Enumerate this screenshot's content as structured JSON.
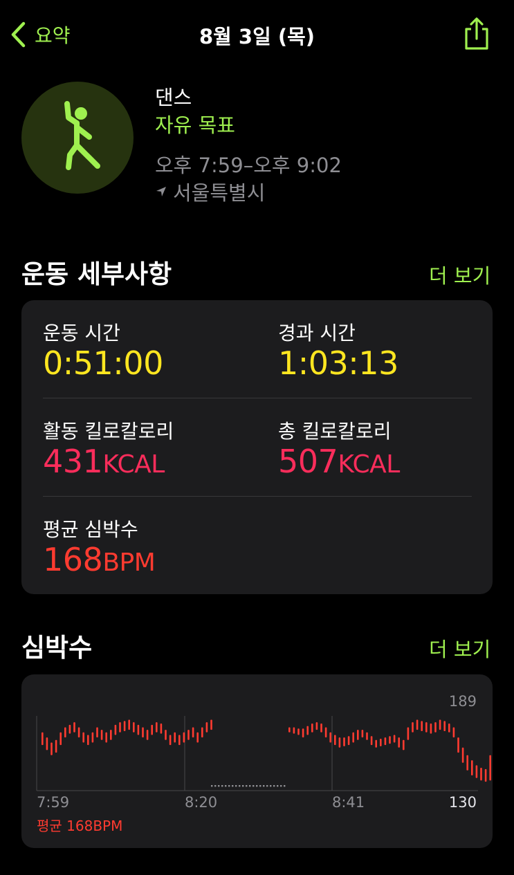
{
  "nav": {
    "back_label": "요약",
    "title": "8월 3일 (목)"
  },
  "workout": {
    "name": "댄스",
    "goal": "자유 목표",
    "time_range": "오후 7:59–오후 9:02",
    "location": "서울특별시"
  },
  "details": {
    "title": "운동 세부사항",
    "more": "더 보기",
    "workout_time": {
      "label": "운동 시간",
      "value": "0:51:00"
    },
    "elapsed_time": {
      "label": "경과 시간",
      "value": "1:03:13"
    },
    "active_calories": {
      "label": "활동 킬로칼로리",
      "value": "431",
      "unit": "KCAL"
    },
    "total_calories": {
      "label": "총 킬로칼로리",
      "value": "507",
      "unit": "KCAL"
    },
    "avg_heart_rate": {
      "label": "평균 심박수",
      "value": "168",
      "unit": "BPM"
    }
  },
  "heart_rate": {
    "title": "심박수",
    "more": "더 보기",
    "average_label": "평균 168BPM"
  },
  "chart_data": {
    "type": "bar",
    "xlabels": [
      "7:59",
      "8:20",
      "8:41"
    ],
    "ymax_label": "189",
    "ymin_label": "130",
    "ylim": [
      130,
      189
    ],
    "segments": [
      {
        "start_minute": 0,
        "bars": [
          [
            166,
            176
          ],
          [
            162,
            172
          ],
          [
            158,
            168
          ],
          [
            160,
            170
          ],
          [
            166,
            176
          ],
          [
            172,
            180
          ],
          [
            175,
            182
          ],
          [
            176,
            184
          ],
          [
            172,
            180
          ],
          [
            168,
            176
          ],
          [
            166,
            174
          ],
          [
            168,
            176
          ],
          [
            172,
            180
          ],
          [
            170,
            178
          ],
          [
            168,
            176
          ],
          [
            170,
            178
          ],
          [
            174,
            182
          ],
          [
            176,
            184
          ],
          [
            177,
            185
          ],
          [
            178,
            186
          ],
          [
            176,
            184
          ],
          [
            174,
            182
          ],
          [
            172,
            180
          ],
          [
            170,
            178
          ],
          [
            174,
            182
          ],
          [
            176,
            184
          ],
          [
            175,
            183
          ],
          [
            170,
            178
          ],
          [
            166,
            174
          ],
          [
            168,
            176
          ],
          [
            166,
            174
          ],
          [
            168,
            176
          ],
          [
            170,
            178
          ],
          [
            172,
            180
          ],
          [
            168,
            176
          ],
          [
            172,
            180
          ],
          [
            176,
            184
          ],
          [
            178,
            186
          ]
        ]
      },
      {
        "start_minute": 30,
        "bars": [
          [
            176,
            180
          ],
          [
            175,
            180
          ],
          [
            174,
            179
          ],
          [
            172,
            179
          ],
          [
            174,
            181
          ],
          [
            176,
            183
          ],
          [
            178,
            184
          ],
          [
            176,
            183
          ],
          [
            172,
            180
          ],
          [
            168,
            176
          ],
          [
            166,
            174
          ],
          [
            164,
            172
          ],
          [
            165,
            172
          ],
          [
            166,
            173
          ],
          [
            168,
            176
          ],
          [
            170,
            178
          ],
          [
            172,
            178
          ],
          [
            170,
            176
          ],
          [
            166,
            173
          ],
          [
            164,
            170
          ],
          [
            165,
            171
          ],
          [
            166,
            172
          ],
          [
            167,
            173
          ],
          [
            168,
            174
          ],
          [
            164,
            172
          ],
          [
            162,
            170
          ],
          [
            170,
            180
          ],
          [
            176,
            184
          ],
          [
            178,
            186
          ],
          [
            177,
            185
          ],
          [
            176,
            184
          ],
          [
            175,
            183
          ],
          [
            176,
            184
          ],
          [
            178,
            186
          ],
          [
            177,
            185
          ],
          [
            176,
            183
          ],
          [
            172,
            180
          ],
          [
            160,
            172
          ],
          [
            152,
            164
          ],
          [
            146,
            158
          ],
          [
            142,
            154
          ],
          [
            140,
            150
          ],
          [
            138,
            148
          ],
          [
            137,
            147
          ],
          [
            138,
            158
          ]
        ]
      }
    ],
    "placeholder_gap": "dotted"
  }
}
